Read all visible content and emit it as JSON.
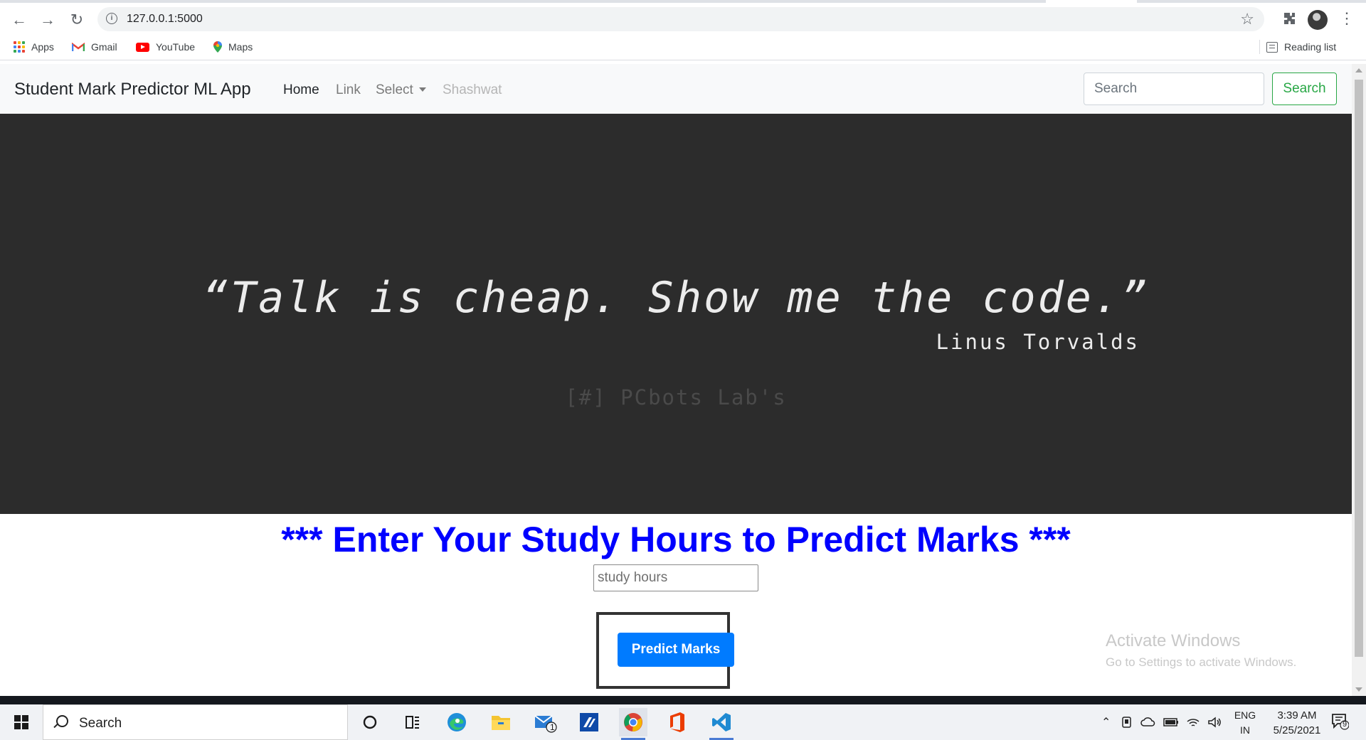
{
  "browser": {
    "url": "127.0.0.1:5000",
    "bookmarks": [
      {
        "label": "Apps",
        "icon": "apps-grid-icon"
      },
      {
        "label": "Gmail",
        "icon": "gmail-icon"
      },
      {
        "label": "YouTube",
        "icon": "youtube-icon"
      },
      {
        "label": "Maps",
        "icon": "maps-icon"
      }
    ],
    "reading_list": "Reading list"
  },
  "navbar": {
    "brand": "Student Mark Predictor ML App",
    "links": {
      "home": "Home",
      "link": "Link",
      "select": "Select",
      "disabled": "Shashwat"
    },
    "search_placeholder": "Search",
    "search_button": "Search",
    "search_color": "#28a745"
  },
  "hero": {
    "quote": "“Talk is cheap. Show me the code.”",
    "author": "Linus Torvalds",
    "watermark": "[#] PCbots Lab's",
    "background": "#2c2c2c"
  },
  "form": {
    "heading": "*** Enter Your Study Hours to Predict Marks ***",
    "heading_color": "#0000ff",
    "input_placeholder": "study hours",
    "button_label": "Predict Marks",
    "button_color": "#007bff"
  },
  "watermark_windows": {
    "title": "Activate Windows",
    "subtitle": "Go to Settings to activate Windows."
  },
  "taskbar": {
    "search_label": "Search",
    "apps": [
      "cortana-icon",
      "task-view-icon",
      "edge-icon",
      "file-explorer-icon",
      "mail-icon",
      "powerapp-icon",
      "chrome-icon",
      "office-icon",
      "vscode-icon"
    ],
    "mail_badge": "1",
    "language": "ENG",
    "region": "IN",
    "time": "3:39 AM",
    "date": "5/25/2021",
    "notification_count": "9"
  }
}
